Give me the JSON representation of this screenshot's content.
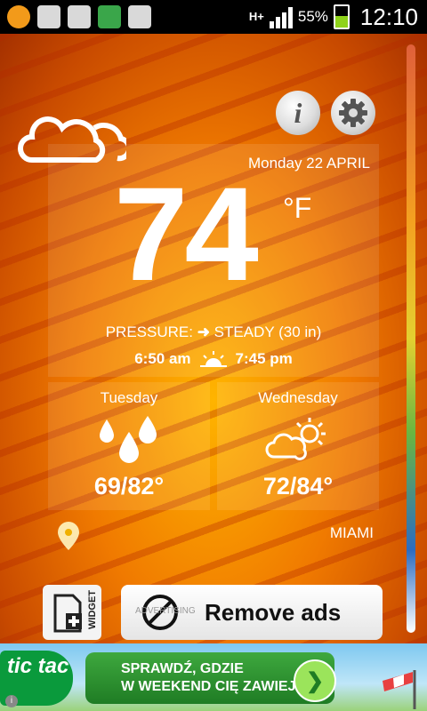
{
  "status_bar": {
    "network": "H+",
    "battery_percent": "55%",
    "time": "12:10"
  },
  "weather": {
    "date": "Monday  22 APRIL",
    "temperature": "74",
    "unit": "°F",
    "pressure_label": "PRESSURE:",
    "pressure_value": "STEADY (30 in)",
    "sunrise": "6:50 am",
    "sunset": "7:45 pm",
    "forecast": [
      {
        "day": "Tuesday",
        "temps": "69/82°",
        "icon": "rain-icon"
      },
      {
        "day": "Wednesday",
        "temps": "72/84°",
        "icon": "partly-sunny-icon"
      }
    ],
    "city": "MIAMI"
  },
  "buttons": {
    "widget_label": "WIDGET",
    "remove_ads_label": "Remove ads",
    "adverts_faint": "ADVERTISING"
  },
  "ad": {
    "brand": "tic tac",
    "line1": "SPRAWDŹ, GDZIE",
    "line2": "W WEEKEND CIĘ ZAWIEJE!"
  },
  "colors": {
    "accent": "#f07a00",
    "ad_green": "#2a9a30"
  }
}
